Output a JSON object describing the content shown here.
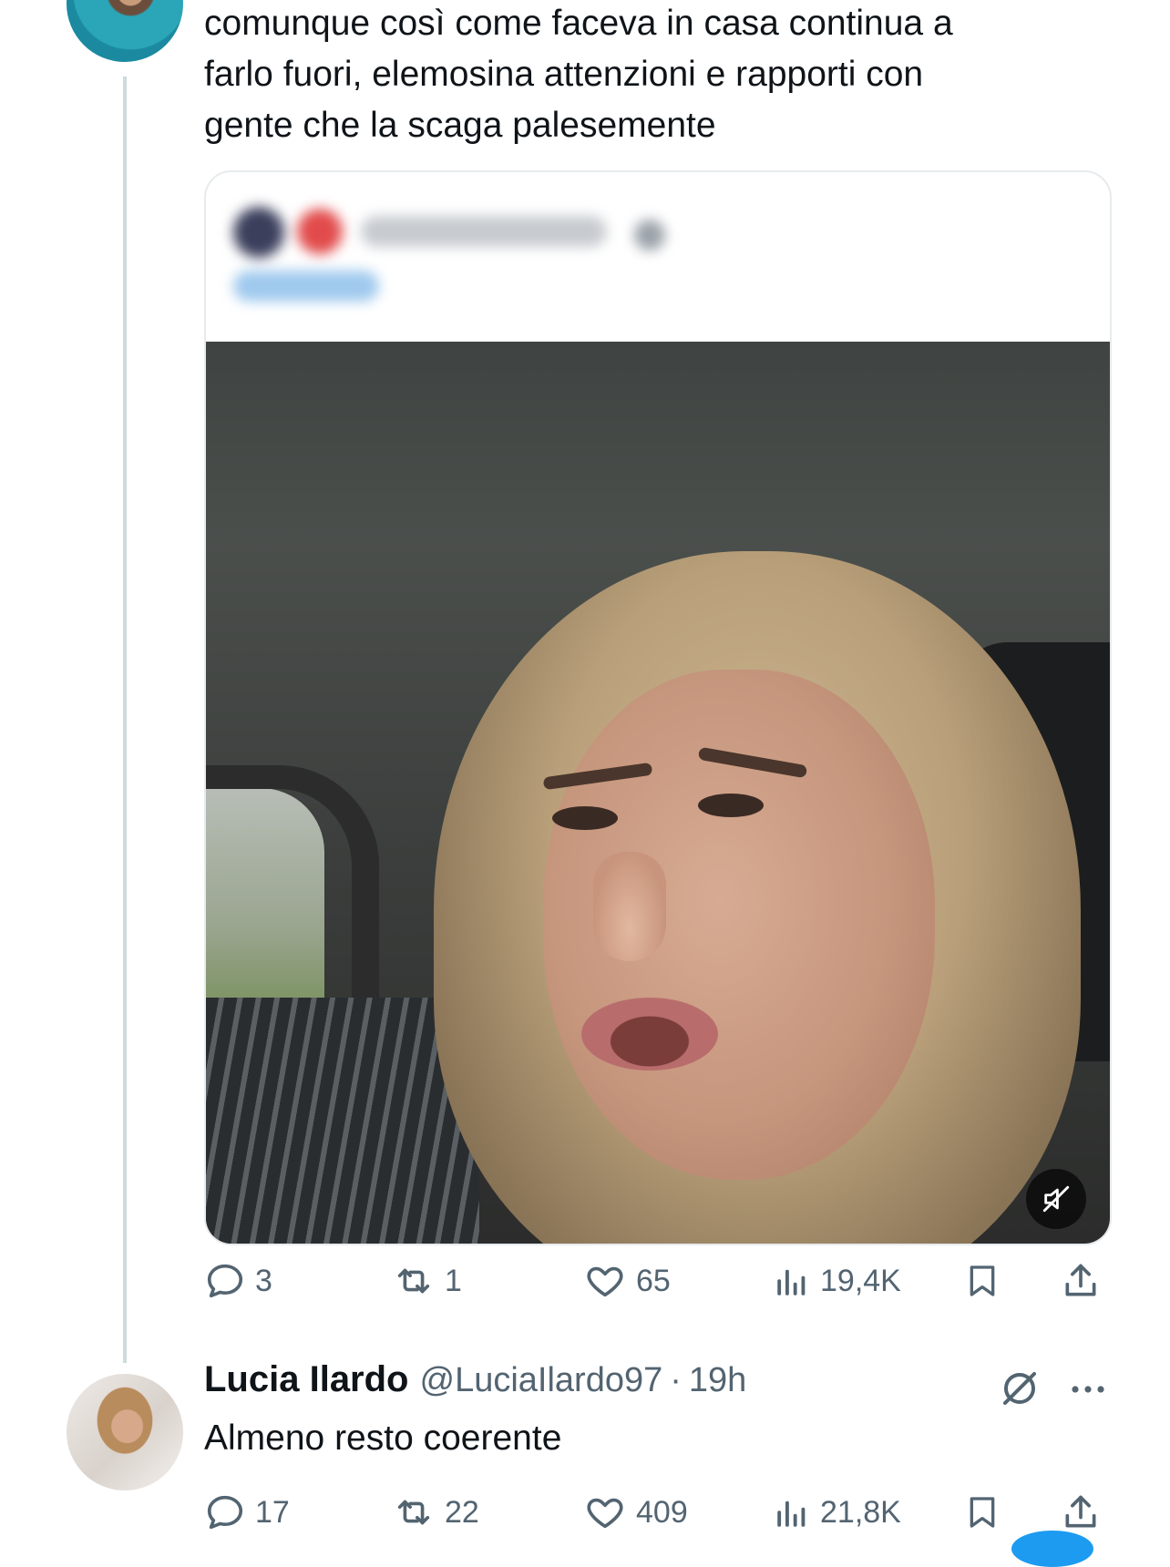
{
  "thread_tweet": {
    "text_lines": [
      "comunque così come faceva in casa continua a",
      "farlo fuori, elemosina attenzioni e rapporti con",
      "gente che la scaga palesemente"
    ],
    "quoted_media": {
      "header_blurred": true,
      "mute_icon": "speaker-muted-icon"
    },
    "actions": {
      "replies": "3",
      "reposts": "1",
      "likes": "65",
      "views": "19,4K"
    }
  },
  "reply_tweet": {
    "name": "Lucia Ilardo",
    "handle": "@LuciaIlardo97",
    "separator": "·",
    "time": "19h",
    "text": "Almeno resto coerente",
    "actions": {
      "replies": "17",
      "reposts": "22",
      "likes": "409",
      "views": "21,8K"
    }
  },
  "colors": {
    "text_primary": "#0f1419",
    "text_secondary": "#536471",
    "thread_line": "#cfd9de",
    "accent": "#1d9bf0"
  }
}
